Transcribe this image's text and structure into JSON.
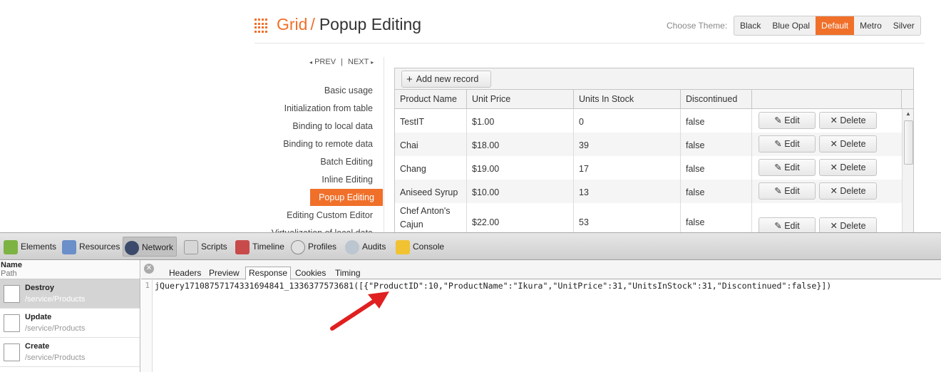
{
  "header": {
    "title_part1": "Grid",
    "title_sep": "/",
    "title_part2": "Popup Editing",
    "theme_label": "Choose Theme:",
    "themes": [
      "Black",
      "Blue Opal",
      "Default",
      "Metro",
      "Silver"
    ],
    "active_theme": "Default"
  },
  "nav": {
    "prev": "PREV",
    "next": "NEXT",
    "items": [
      "Basic usage",
      "Initialization from table",
      "Binding to local data",
      "Binding to remote data",
      "Batch Editing",
      "Inline Editing",
      "Popup Editing",
      "Editing Custom Editor",
      "Virtualization of local data"
    ],
    "active": "Popup Editing"
  },
  "grid": {
    "add_label": "Add new record",
    "columns": [
      "Product Name",
      "Unit Price",
      "Units In Stock",
      "Discontinued"
    ],
    "edit_label": "Edit",
    "delete_label": "Delete",
    "rows": [
      [
        "TestIT",
        "$1.00",
        "0",
        "false"
      ],
      [
        "Chai",
        "$18.00",
        "39",
        "false"
      ],
      [
        "Chang",
        "$19.00",
        "17",
        "false"
      ],
      [
        "Aniseed Syrup",
        "$10.00",
        "13",
        "false"
      ],
      [
        "Chef Anton's Cajun",
        "$22.00",
        "53",
        "false"
      ]
    ]
  },
  "devtools": {
    "panels": [
      "Elements",
      "Resources",
      "Network",
      "Scripts",
      "Timeline",
      "Profiles",
      "Audits",
      "Console"
    ],
    "active_panel": "Network",
    "list_header_name": "Name",
    "list_header_path": "Path",
    "requests": [
      {
        "name": "Destroy",
        "path": "/service/Products"
      },
      {
        "name": "Update",
        "path": "/service/Products"
      },
      {
        "name": "Create",
        "path": "/service/Products"
      }
    ],
    "tabs": [
      "Headers",
      "Preview",
      "Response",
      "Cookies",
      "Timing"
    ],
    "active_tab": "Response",
    "line_number": "1",
    "response": "jQuery17108757174331694841_1336377573681([{\"ProductID\":10,\"ProductName\":\"Ikura\",\"UnitPrice\":31,\"UnitsInStock\":31,\"Discontinued\":false}])"
  },
  "colors": {
    "accent": "#f0702a",
    "arrow": "#e02020"
  }
}
